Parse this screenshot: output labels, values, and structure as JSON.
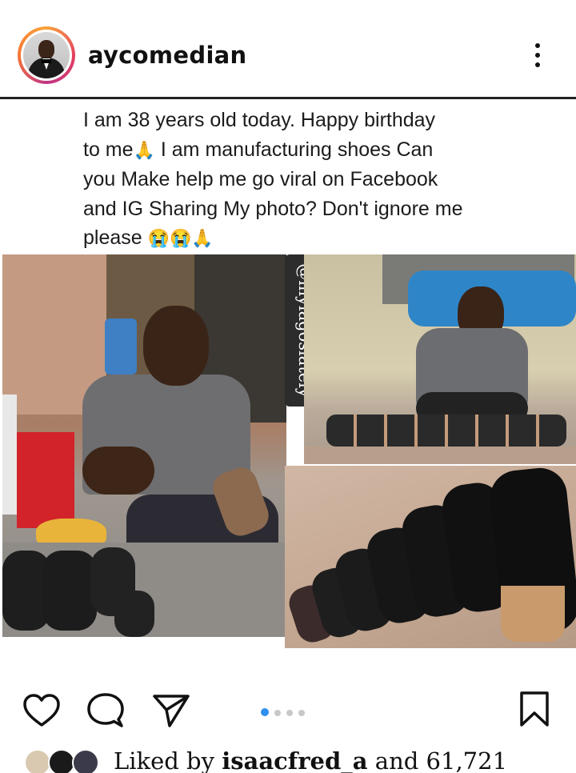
{
  "post": {
    "username": "aycomedian",
    "caption": {
      "line1": "I am 38 years old today. Happy birthday",
      "line2_a": "to me",
      "line2_b": " I am  manufacturing shoes Can",
      "line3": "you Make help me go viral on Facebook",
      "line4": "and IG Sharing My photo?  Don't ignore me",
      "line5": "please",
      "emoji_pray": "🙏",
      "emoji_cry": "😭😭"
    },
    "watermark": "@mylagoslately",
    "carousel": {
      "count": 4,
      "active": 1
    },
    "likes": {
      "prefix": "Liked by ",
      "user": "isaacfred_a",
      "suffix": " and 61,721"
    }
  },
  "icons": {
    "more": "more-vertical-icon",
    "like": "heart-icon",
    "comment": "comment-icon",
    "share": "send-icon",
    "save": "bookmark-icon"
  },
  "colors": {
    "carousel_active": "#2f8ff0",
    "carousel_inactive": "#c8c8c8",
    "avatar_ring": "#e4405f"
  }
}
